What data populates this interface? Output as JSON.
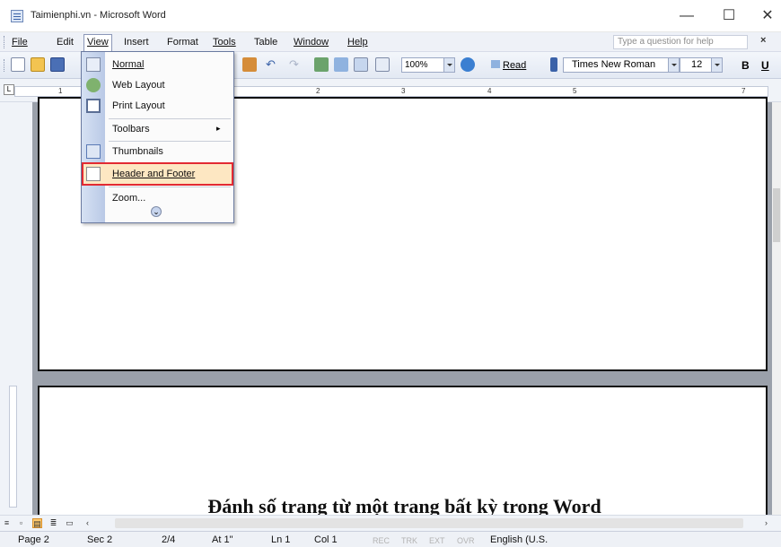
{
  "window": {
    "title": "Taimienphi.vn - Microsoft Word",
    "minimize": "—",
    "maximize": "☐",
    "close": "✕"
  },
  "menubar": {
    "items": [
      "File",
      "Edit",
      "View",
      "Insert",
      "Format",
      "Tools",
      "Table",
      "Window",
      "Help"
    ],
    "help_placeholder": "Type a question for help",
    "help_close": "×"
  },
  "toolbar": {
    "zoom": "100%",
    "read_label": "Read",
    "font": "Times New Roman",
    "size": "12",
    "bold": "B",
    "underline": "U"
  },
  "ruler": {
    "numbers": [
      "1",
      "2",
      "3",
      "4",
      "5",
      "7"
    ]
  },
  "view_menu": {
    "items": [
      {
        "label": "Normal",
        "icon": "normal-view-icon"
      },
      {
        "label": "Web Layout",
        "icon": "web-layout-icon"
      },
      {
        "label": "Print Layout",
        "icon": "print-layout-icon"
      },
      {
        "label": "Toolbars",
        "icon": "",
        "submenu": "▸"
      },
      {
        "label": "Thumbnails",
        "icon": "thumbnails-icon"
      },
      {
        "label": "Header and Footer",
        "icon": "header-footer-icon",
        "highlighted": true
      },
      {
        "label": "Zoom...",
        "icon": ""
      }
    ],
    "expand_glyph": "⌄"
  },
  "document": {
    "heading": "Đánh số trang từ một trang bất kỳ trong Word"
  },
  "statusbar": {
    "page": "Page 2",
    "sec": "Sec 2",
    "pages": "2/4",
    "at": "At 1\"",
    "ln": "Ln 1",
    "col": "Col 1",
    "rec": "REC",
    "trk": "TRK",
    "ext": "EXT",
    "ovr": "OVR",
    "language": "English (U.S."
  },
  "colors": {
    "highlight_border": "#e22a32",
    "highlight_fill": "#fde7c2",
    "menubar": "#eef1f7"
  }
}
